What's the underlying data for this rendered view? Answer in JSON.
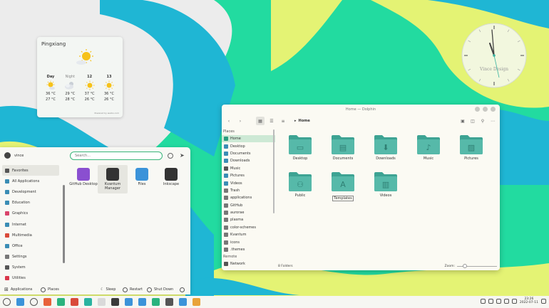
{
  "weather": {
    "city": "Pingxiang",
    "columns": [
      {
        "label": "Day",
        "high": "36 °C",
        "low": "27 °C",
        "icon": "sun-cloud-icon"
      },
      {
        "label": "Night",
        "high": "29 °C",
        "low": "28 °C",
        "icon": "cloud-moon-icon"
      },
      {
        "label": "12",
        "high": "37 °C",
        "low": "26 °C",
        "icon": "sun-icon"
      },
      {
        "label": "13",
        "high": "36 °C",
        "low": "26 °C",
        "icon": "sun-icon"
      }
    ],
    "powered": "Powered by weibo.com"
  },
  "clock": {
    "label": "Vince Design",
    "time": "23:26"
  },
  "dolphin": {
    "title": "Home — Dolphin",
    "breadcrumb": "Home",
    "places_header": "Places",
    "remote_header": "Remote",
    "places": [
      {
        "label": "Home",
        "icon": "home-icon",
        "color": "#2a9c7e"
      },
      {
        "label": "Desktop",
        "icon": "desktop-icon",
        "color": "#3a8db5"
      },
      {
        "label": "Documents",
        "icon": "documents-icon",
        "color": "#3a8db5"
      },
      {
        "label": "Downloads",
        "icon": "downloads-icon",
        "color": "#3a8db5"
      },
      {
        "label": "Music",
        "icon": "music-icon",
        "color": "#555555"
      },
      {
        "label": "Pictures",
        "icon": "pictures-icon",
        "color": "#3a8db5"
      },
      {
        "label": "Videos",
        "icon": "videos-icon",
        "color": "#3a8db5"
      },
      {
        "label": "Trash",
        "icon": "trash-icon",
        "color": "#777777"
      },
      {
        "label": "applications",
        "icon": "folder-icon",
        "color": "#777777"
      },
      {
        "label": "GitHub",
        "icon": "folder-icon",
        "color": "#777777"
      },
      {
        "label": "aurorae",
        "icon": "folder-icon",
        "color": "#777777"
      },
      {
        "label": "plasma",
        "icon": "folder-icon",
        "color": "#777777"
      },
      {
        "label": "color-schemes",
        "icon": "folder-icon",
        "color": "#777777"
      },
      {
        "label": "Kvantum",
        "icon": "folder-icon",
        "color": "#777777"
      },
      {
        "label": "icons",
        "icon": "folder-icon",
        "color": "#777777"
      },
      {
        "label": ".themes",
        "icon": "folder-icon",
        "color": "#777777"
      }
    ],
    "remote": [
      {
        "label": "Network",
        "icon": "network-icon",
        "color": "#555555"
      }
    ],
    "folders": [
      {
        "label": "Desktop",
        "icon": "desktop-icon"
      },
      {
        "label": "Documents",
        "icon": "documents-icon"
      },
      {
        "label": "Downloads",
        "icon": "downloads-icon"
      },
      {
        "label": "Music",
        "icon": "music-icon"
      },
      {
        "label": "Pictures",
        "icon": "pictures-icon"
      },
      {
        "label": "Public",
        "icon": "public-icon"
      },
      {
        "label": "Templates",
        "icon": "templates-icon"
      },
      {
        "label": "Videos",
        "icon": "videos-icon"
      }
    ],
    "status": "8 Folders",
    "zoom_label": "Zoom:",
    "zoom_level": 0.15
  },
  "launcher": {
    "user": "vince",
    "search_placeholder": "Search...",
    "categories": [
      {
        "label": "Favorites",
        "color": "#555555"
      },
      {
        "label": "All Applications",
        "color": "#3a8db5"
      },
      {
        "label": "Development",
        "color": "#3a8db5"
      },
      {
        "label": "Education",
        "color": "#3a8db5"
      },
      {
        "label": "Graphics",
        "color": "#d9436a"
      },
      {
        "label": "Internet",
        "color": "#3a8db5"
      },
      {
        "label": "Multimedia",
        "color": "#d94a3a"
      },
      {
        "label": "Office",
        "color": "#3a8db5"
      },
      {
        "label": "Settings",
        "color": "#777777"
      },
      {
        "label": "System",
        "color": "#555555"
      },
      {
        "label": "Utilities",
        "color": "#d9364a"
      }
    ],
    "apps": [
      {
        "label": "GitHub Desktop",
        "color": "#8a4fd0"
      },
      {
        "label": "Kvantum Manager",
        "color": "#333333"
      },
      {
        "label": "Files",
        "color": "#3b93d9"
      },
      {
        "label": "Inkscape",
        "color": "#333333"
      }
    ],
    "footer": {
      "applications": "Applications",
      "places": "Places",
      "sleep": "Sleep",
      "restart": "Restart",
      "shutdown": "Shut Down"
    }
  },
  "taskbar": {
    "apps": [
      {
        "name": "launcher-icon",
        "color": "#555555"
      },
      {
        "name": "files-icon",
        "color": "#3b93d9"
      },
      {
        "name": "steam-icon",
        "color": "#555555"
      },
      {
        "name": "firefox-icon",
        "color": "#e8623a"
      },
      {
        "name": "settings-icon",
        "color": "#2ab37e"
      },
      {
        "name": "chrome-icon",
        "color": "#d94a3a"
      },
      {
        "name": "discover-icon",
        "color": "#2ab3a0"
      },
      {
        "name": "editor-icon",
        "color": "#d9d9d9"
      },
      {
        "name": "video-icon",
        "color": "#3a3a3a"
      },
      {
        "name": "dot-icon",
        "color": "#3b93d9"
      },
      {
        "name": "mail-icon",
        "color": "#3b93d9"
      },
      {
        "name": "music-icon",
        "color": "#2ab37e"
      },
      {
        "name": "monitor-icon",
        "color": "#555555"
      },
      {
        "name": "folder-icon",
        "color": "#3b93d9"
      },
      {
        "name": "chrome-icon",
        "color": "#e8a33a"
      }
    ],
    "time": "23:26",
    "date": "2022-07-11"
  }
}
